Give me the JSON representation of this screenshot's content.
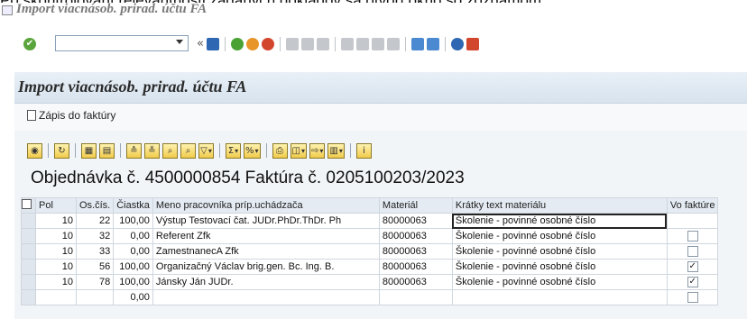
{
  "window": {
    "top_cut_text": "Po skontrolovaní relevantnosti zadaných dokladov sa otvorí okno so zoznamom",
    "title": "Import viacnásob. prirad. účtu FA"
  },
  "toolbar": {
    "command_value": "",
    "icons": [
      "enter-icon",
      "save-icon",
      "back-icon",
      "exit-icon",
      "cancel-icon",
      "print-icon",
      "find-icon",
      "find-next-icon",
      "first-page-icon",
      "prev-page-icon",
      "next-page-icon",
      "last-page-icon",
      "new-session-icon",
      "shortcut-icon",
      "help-icon",
      "layout-icon"
    ]
  },
  "header": {
    "title": "Import viacnásob. prirad. účtu FA"
  },
  "app_toolbar": {
    "button_label": "Zápis do faktúry"
  },
  "alv_toolbar": {
    "icons": [
      "details-icon",
      "refresh-icon",
      "select-all-icon",
      "deselect-all-icon",
      "sort-asc-icon",
      "sort-desc-icon",
      "find-icon",
      "find-next-icon",
      "filter-icon",
      "sum-icon",
      "subtotal-icon",
      "print-icon",
      "views-icon",
      "export-icon",
      "layout-icon",
      "info-icon"
    ]
  },
  "heading": "Objednávka č. 4500000854 Faktúra č. 0205100203/2023",
  "table": {
    "columns": [
      "Pol",
      "Os.čís.",
      "Čiastka",
      "Meno pracovníka príp.uchádzača",
      "Materiál",
      "Krátky text materiálu",
      "Vo faktúre"
    ],
    "rows": [
      {
        "pol": "10",
        "os": "22",
        "ciastka": "100,00",
        "meno": "Výstup Testovací čat. JUDr.PhDr.ThDr. Ph",
        "material": "80000063",
        "text": "Školenie - povinné osobné číslo",
        "vofak": "",
        "focus": true
      },
      {
        "pol": "10",
        "os": "32",
        "ciastka": "0,00",
        "meno": "Referent Zfk",
        "material": "80000063",
        "text": "Školenie - povinné osobné číslo",
        "vofak": "unchecked"
      },
      {
        "pol": "10",
        "os": "33",
        "ciastka": "0,00",
        "meno": "ZamestnanecA Zfk",
        "material": "80000063",
        "text": "Školenie - povinné osobné číslo",
        "vofak": "unchecked"
      },
      {
        "pol": "10",
        "os": "56",
        "ciastka": "100,00",
        "meno": "Organizačný Václav brig.gen. Bc. Ing. B.",
        "material": "80000063",
        "text": "Školenie - povinné osobné číslo",
        "vofak": "checked"
      },
      {
        "pol": "10",
        "os": "78",
        "ciastka": "100,00",
        "meno": "Jánsky Ján JUDr.",
        "material": "80000063",
        "text": "Školenie - povinné osobné číslo",
        "vofak": "checked"
      },
      {
        "pol": "",
        "os": "",
        "ciastka": "0,00",
        "meno": "",
        "material": "",
        "text": "",
        "vofak": "unchecked"
      }
    ]
  },
  "colors": {
    "accent": "#2a5ea8",
    "header_bg": "#d7e3ee",
    "alv_button": "#f1cb4a"
  }
}
